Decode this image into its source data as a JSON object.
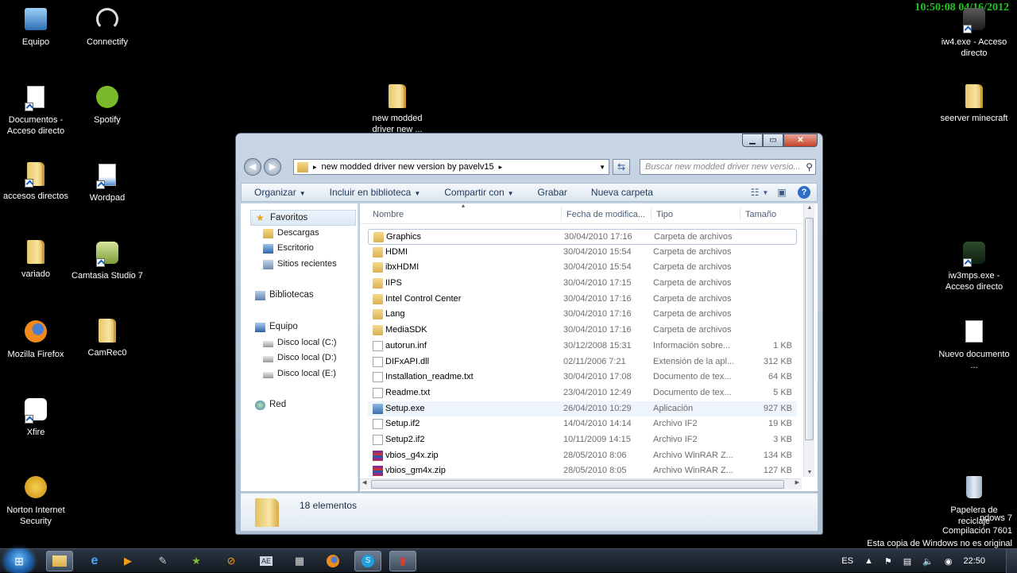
{
  "screen_overlay": {
    "clock": "10:50:08  04/16/2012"
  },
  "desktop_icons": [
    {
      "id": "equipo",
      "label": "Equipo"
    },
    {
      "id": "connectify",
      "label": "Connectify"
    },
    {
      "id": "documentos",
      "label": "Documentos - Acceso directo"
    },
    {
      "id": "spotify",
      "label": "Spotify"
    },
    {
      "id": "new-modded",
      "label": "new modded driver new ..."
    },
    {
      "id": "accesos",
      "label": "accesos directos"
    },
    {
      "id": "wordpad",
      "label": "Wordpad"
    },
    {
      "id": "variado",
      "label": "variado"
    },
    {
      "id": "camtasia",
      "label": "Camtasia Studio 7"
    },
    {
      "id": "firefox",
      "label": "Mozilla Firefox"
    },
    {
      "id": "camrec",
      "label": "CamRec0"
    },
    {
      "id": "xfire",
      "label": "Xfire"
    },
    {
      "id": "norton",
      "label": "Norton Internet Security"
    },
    {
      "id": "iw4",
      "label": "iw4.exe - Acceso directo"
    },
    {
      "id": "seerver",
      "label": "seerver minecraft"
    },
    {
      "id": "iw3mps",
      "label": "iw3mps.exe - Acceso directo"
    },
    {
      "id": "nuevo-doc",
      "label": "Nuevo documento ..."
    },
    {
      "id": "papelera",
      "label": "Papelera de reciclaje"
    }
  ],
  "watermark": {
    "line1": "ndows 7",
    "line2": "Compilación  7601",
    "line3": "Esta copia de Windows no es original"
  },
  "explorer": {
    "address": "new modded driver new version by pavelv15",
    "search_placeholder": "Buscar new modded driver new versio...",
    "toolbar": {
      "organize": "Organizar",
      "include": "Incluir en biblioteca",
      "share": "Compartir con",
      "burn": "Grabar",
      "new_folder": "Nueva carpeta"
    },
    "nav": {
      "favorites": "Favoritos",
      "favorite_items": [
        "Descargas",
        "Escritorio",
        "Sitios recientes"
      ],
      "libraries": "Bibliotecas",
      "computer": "Equipo",
      "drives": [
        "Disco local (C:)",
        "Disco local (D:)",
        "Disco local (E:)"
      ],
      "network": "Red"
    },
    "columns": {
      "name": "Nombre",
      "date": "Fecha de modifica...",
      "type": "Tipo",
      "size": "Tamaño"
    },
    "files": [
      {
        "name": "Graphics",
        "date": "30/04/2010 17:16",
        "type": "Carpeta de archivos",
        "size": "",
        "kind": "folder"
      },
      {
        "name": "HDMI",
        "date": "30/04/2010 15:54",
        "type": "Carpeta de archivos",
        "size": "",
        "kind": "folder"
      },
      {
        "name": "ibxHDMI",
        "date": "30/04/2010 15:54",
        "type": "Carpeta de archivos",
        "size": "",
        "kind": "folder"
      },
      {
        "name": "IIPS",
        "date": "30/04/2010 17:15",
        "type": "Carpeta de archivos",
        "size": "",
        "kind": "folder"
      },
      {
        "name": "Intel Control Center",
        "date": "30/04/2010 17:16",
        "type": "Carpeta de archivos",
        "size": "",
        "kind": "folder"
      },
      {
        "name": "Lang",
        "date": "30/04/2010 17:16",
        "type": "Carpeta de archivos",
        "size": "",
        "kind": "folder"
      },
      {
        "name": "MediaSDK",
        "date": "30/04/2010 17:16",
        "type": "Carpeta de archivos",
        "size": "",
        "kind": "folder"
      },
      {
        "name": "autorun.inf",
        "date": "30/12/2008 15:31",
        "type": "Información sobre...",
        "size": "1 KB",
        "kind": "file"
      },
      {
        "name": "DIFxAPI.dll",
        "date": "02/11/2006 7:21",
        "type": "Extensión de la apl...",
        "size": "312 KB",
        "kind": "file"
      },
      {
        "name": "Installation_readme.txt",
        "date": "30/04/2010 17:08",
        "type": "Documento de tex...",
        "size": "64 KB",
        "kind": "file"
      },
      {
        "name": "Readme.txt",
        "date": "23/04/2010 12:49",
        "type": "Documento de tex...",
        "size": "5 KB",
        "kind": "file"
      },
      {
        "name": "Setup.exe",
        "date": "26/04/2010 10:29",
        "type": "Aplicación",
        "size": "927 KB",
        "kind": "exe"
      },
      {
        "name": "Setup.if2",
        "date": "14/04/2010 14:14",
        "type": "Archivo IF2",
        "size": "19 KB",
        "kind": "file"
      },
      {
        "name": "Setup2.if2",
        "date": "10/11/2009 14:15",
        "type": "Archivo IF2",
        "size": "3 KB",
        "kind": "file"
      },
      {
        "name": "vbios_g4x.zip",
        "date": "28/05/2010 8:06",
        "type": "Archivo WinRAR Z...",
        "size": "134 KB",
        "kind": "zip"
      },
      {
        "name": "vbios_gm4x.zip",
        "date": "28/05/2010 8:05",
        "type": "Archivo WinRAR Z...",
        "size": "127 KB",
        "kind": "zip"
      }
    ],
    "status": "18 elementos"
  },
  "taskbar": {
    "lang": "ES",
    "time": "22:50"
  }
}
